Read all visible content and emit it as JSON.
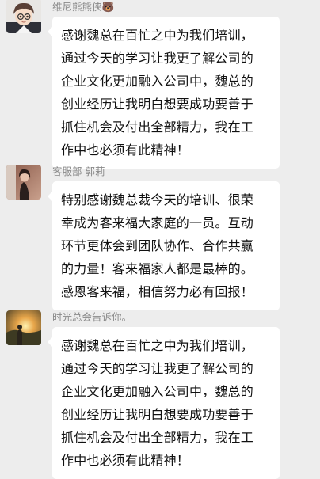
{
  "messages": [
    {
      "sender": "维尼熊熊侠🐻",
      "avatar": "cartoon-boy-avatar",
      "lines": [
        "感谢魏总在百忙之中为我们培训，",
        "通过今天的学习让我更了解公司的",
        "企业文化更加融入公司中，魏总的",
        "创业经历让我明白想要成功要善于",
        "抓住机会及付出全部精力，我在工",
        "作中也必须有此精神！"
      ]
    },
    {
      "sender": "客服部 郭莉",
      "avatar": "person-photo-avatar",
      "lines": [
        "特别感谢魏总裁今天的培训、很荣",
        "幸成为客来福大家庭的一员。互动",
        "环节更体会到团队协作、合作共赢",
        "的力量！客来福家人都是最棒的。",
        "感恩客来福，相信努力必有回报！"
      ]
    },
    {
      "sender": "时光总会告诉你。",
      "avatar": "sunset-photo-avatar",
      "lines": [
        "感谢魏总在百忙之中为我们培训，",
        "通过今天的学习让我更了解公司的",
        "企业文化更加融入公司中，魏总的",
        "创业经历让我明白想要成功要善于",
        "抓住机会及付出全部精力，我在工",
        "作中也必须有此精神！"
      ]
    }
  ]
}
